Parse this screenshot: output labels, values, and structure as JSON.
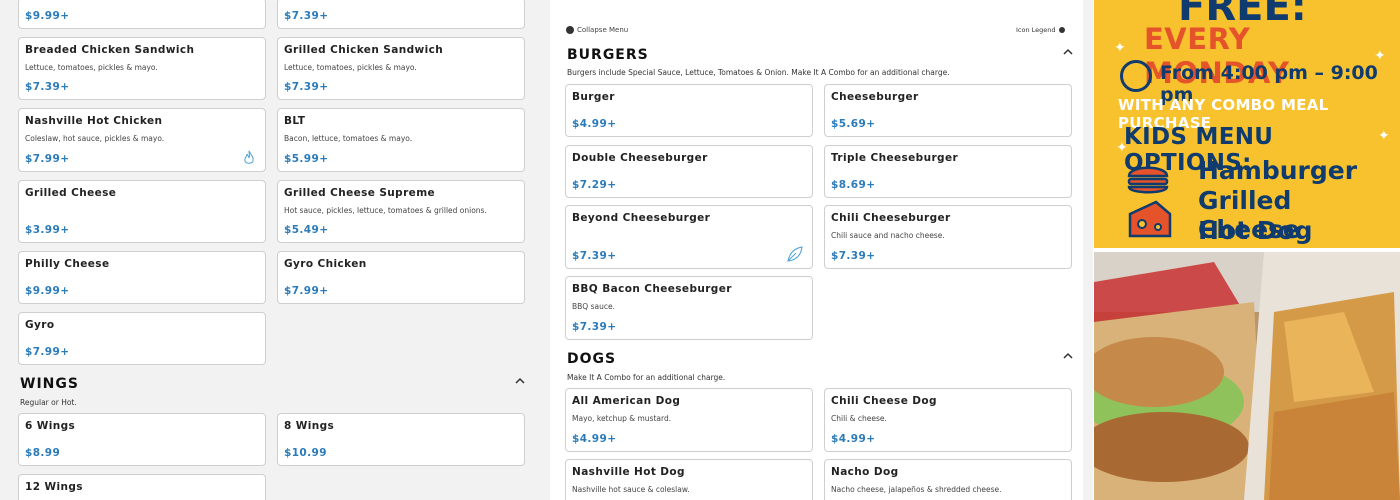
{
  "left": {
    "cards": [
      {
        "name": "",
        "desc": "",
        "price": "$9.99+"
      },
      {
        "name": "",
        "desc": "",
        "price": "$7.39+"
      },
      {
        "name": "Breaded Chicken Sandwich",
        "desc": "Lettuce, tomatoes, pickles & mayo.",
        "price": "$7.39+"
      },
      {
        "name": "Grilled Chicken Sandwich",
        "desc": "Lettuce, tomatoes, pickles & mayo.",
        "price": "$7.39+"
      },
      {
        "name": "Nashville Hot Chicken",
        "desc": "Coleslaw, hot sauce, pickles & mayo.",
        "price": "$7.99+"
      },
      {
        "name": "BLT",
        "desc": "Bacon, lettuce, tomatoes & mayo.",
        "price": "$5.99+"
      },
      {
        "name": "Grilled Cheese",
        "desc": "",
        "price": "$3.99+"
      },
      {
        "name": "Grilled Cheese Supreme",
        "desc": "Hot sauce, pickles, lettuce, tomatoes & grilled onions.",
        "price": "$5.49+"
      },
      {
        "name": "Philly Cheese",
        "desc": "",
        "price": "$9.99+"
      },
      {
        "name": "Gyro Chicken",
        "desc": "",
        "price": "$7.99+"
      },
      {
        "name": "Gyro",
        "desc": "",
        "price": "$7.99+"
      }
    ],
    "wings": {
      "title": "WINGS",
      "subtitle": "Regular or Hot.",
      "cards": [
        {
          "name": "6 Wings",
          "price": "$8.99"
        },
        {
          "name": "8 Wings",
          "price": "$10.99"
        },
        {
          "name": "12 Wings",
          "price": ""
        }
      ]
    }
  },
  "menu": {
    "collapse_label": "Collapse Menu",
    "legend_label": "Icon Legend",
    "burgers": {
      "title": "BURGERS",
      "subtitle": "Burgers include Special Sauce, Lettuce, Tomatoes & Onion. Make It A Combo for an additional charge.",
      "cards": [
        {
          "name": "Burger",
          "desc": "",
          "price": "$4.99+"
        },
        {
          "name": "Cheeseburger",
          "desc": "",
          "price": "$5.69+"
        },
        {
          "name": "Double Cheeseburger",
          "desc": "",
          "price": "$7.29+"
        },
        {
          "name": "Triple Cheeseburger",
          "desc": "",
          "price": "$8.69+"
        },
        {
          "name": "Beyond Cheeseburger",
          "desc": "",
          "price": "$7.39+"
        },
        {
          "name": "Chili Cheeseburger",
          "desc": "Chili sauce and nacho cheese.",
          "price": "$7.39+"
        },
        {
          "name": "BBQ Bacon Cheeseburger",
          "desc": "BBQ sauce.",
          "price": "$7.39+"
        }
      ]
    },
    "dogs": {
      "title": "DOGS",
      "subtitle": "Make It A Combo for an additional charge.",
      "cards": [
        {
          "name": "All American Dog",
          "desc": "Mayo, ketchup & mustard.",
          "price": "$4.99+"
        },
        {
          "name": "Chili Cheese Dog",
          "desc": "Chili & cheese.",
          "price": "$4.99+"
        },
        {
          "name": "Nashville Hot Dog",
          "desc": "Nashville hot sauce & coleslaw.",
          "price": ""
        },
        {
          "name": "Nacho Dog",
          "desc": "Nacho cheese, jalapeños & shredded cheese.",
          "price": ""
        }
      ]
    }
  },
  "promo": {
    "headline": "FREE:",
    "day": "EVERY MONDAY",
    "time": "From 4:00 pm – 9:00 pm",
    "condition": "WITH ANY COMBO MEAL PURCHASE",
    "kids_title": "KIDS MENU OPTIONS:",
    "items": [
      "Hamburger",
      "Grilled Cheese",
      "Hot Dog"
    ]
  },
  "colors": {
    "price": "#2b7bb9",
    "promo_bg": "#f8c22e",
    "promo_navy": "#0f3b6e",
    "promo_orange": "#e4532a"
  }
}
